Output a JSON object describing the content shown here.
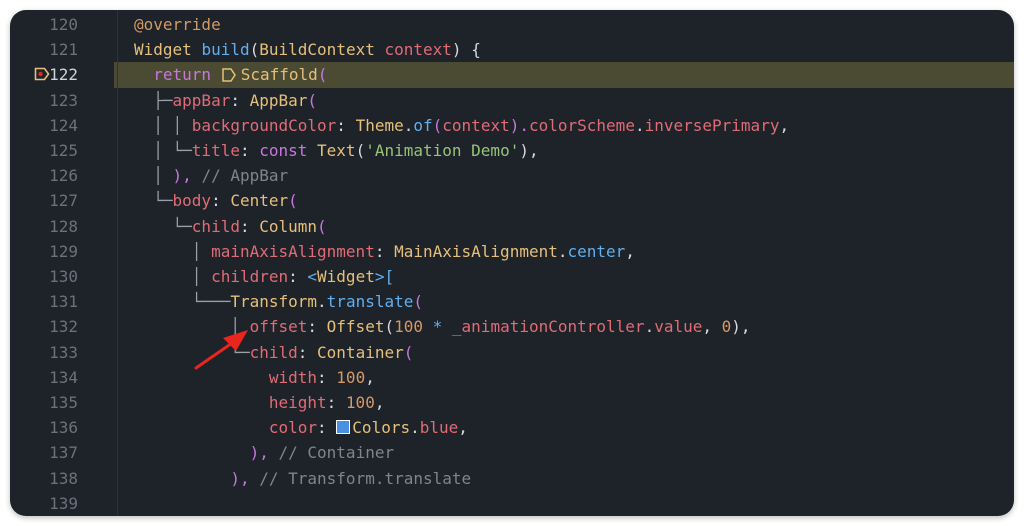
{
  "editor": {
    "lines": [
      {
        "num": "120",
        "tokens": [
          {
            "t": "@override",
            "c": "dec"
          }
        ]
      },
      {
        "num": "121",
        "tokens": [
          {
            "t": "Widget ",
            "c": "type"
          },
          {
            "t": "build",
            "c": "meth"
          },
          {
            "t": "(",
            "c": "p"
          },
          {
            "t": "BuildContext ",
            "c": "type"
          },
          {
            "t": "context",
            "c": "prop"
          },
          {
            "t": ") {",
            "c": "p"
          }
        ]
      },
      {
        "num": "122",
        "highlight": true,
        "breakpoint": true,
        "tokens": [
          {
            "t": "  return ",
            "c": "kw"
          },
          {
            "icon": "widget"
          },
          {
            "t": "Scaffold",
            "c": "type"
          },
          {
            "t": "(",
            "c": "pv"
          }
        ]
      },
      {
        "num": "123",
        "tokens": [
          {
            "t": "  ├─",
            "c": "guide"
          },
          {
            "t": "appBar",
            "c": "prop"
          },
          {
            "t": ": ",
            "c": "p"
          },
          {
            "t": "AppBar",
            "c": "type"
          },
          {
            "t": "(",
            "c": "pv"
          }
        ]
      },
      {
        "num": "124",
        "tokens": [
          {
            "t": "  │ │ ",
            "c": "guide"
          },
          {
            "t": "backgroundColor",
            "c": "prop"
          },
          {
            "t": ": ",
            "c": "p"
          },
          {
            "t": "Theme",
            "c": "type"
          },
          {
            "t": ".",
            "c": "p"
          },
          {
            "t": "of",
            "c": "meth"
          },
          {
            "t": "(",
            "c": "pv"
          },
          {
            "t": "context",
            "c": "prop"
          },
          {
            "t": ").",
            "c": "pv"
          },
          {
            "t": "colorScheme",
            "c": "prop"
          },
          {
            "t": ".",
            "c": "p"
          },
          {
            "t": "inversePrimary",
            "c": "prop"
          },
          {
            "t": ",",
            "c": "p"
          }
        ]
      },
      {
        "num": "125",
        "tokens": [
          {
            "t": "  │ └─",
            "c": "guide"
          },
          {
            "t": "title",
            "c": "prop"
          },
          {
            "t": ": ",
            "c": "p"
          },
          {
            "t": "const ",
            "c": "kw"
          },
          {
            "t": "Text",
            "c": "type"
          },
          {
            "t": "(",
            "c": "p"
          },
          {
            "t": "'Animation Demo'",
            "c": "str"
          },
          {
            "t": "),",
            "c": "p"
          }
        ]
      },
      {
        "num": "126",
        "tokens": [
          {
            "t": "  │ ",
            "c": "guide"
          },
          {
            "t": "), ",
            "c": "pv"
          },
          {
            "t": "// AppBar",
            "c": "cm"
          }
        ]
      },
      {
        "num": "127",
        "tokens": [
          {
            "t": "  └─",
            "c": "guide"
          },
          {
            "t": "body",
            "c": "prop"
          },
          {
            "t": ": ",
            "c": "p"
          },
          {
            "t": "Center",
            "c": "type"
          },
          {
            "t": "(",
            "c": "pv"
          }
        ]
      },
      {
        "num": "128",
        "tokens": [
          {
            "t": "    └─",
            "c": "guide"
          },
          {
            "t": "child",
            "c": "prop"
          },
          {
            "t": ": ",
            "c": "p"
          },
          {
            "t": "Column",
            "c": "type"
          },
          {
            "t": "(",
            "c": "pv"
          }
        ]
      },
      {
        "num": "129",
        "tokens": [
          {
            "t": "      │ ",
            "c": "guide"
          },
          {
            "t": "mainAxisAlignment",
            "c": "prop"
          },
          {
            "t": ": ",
            "c": "p"
          },
          {
            "t": "MainAxisAlignment",
            "c": "type"
          },
          {
            "t": ".",
            "c": "p"
          },
          {
            "t": "center",
            "c": "meth"
          },
          {
            "t": ",",
            "c": "p"
          }
        ]
      },
      {
        "num": "130",
        "tokens": [
          {
            "t": "      │ ",
            "c": "guide"
          },
          {
            "t": "children",
            "c": "prop"
          },
          {
            "t": ": ",
            "c": "p"
          },
          {
            "t": "<",
            "c": "meth"
          },
          {
            "t": "Widget",
            "c": "type"
          },
          {
            "t": ">[",
            "c": "meth"
          }
        ]
      },
      {
        "num": "131",
        "tokens": [
          {
            "t": "      └───",
            "c": "guide"
          },
          {
            "t": "Transform",
            "c": "type"
          },
          {
            "t": ".",
            "c": "p"
          },
          {
            "t": "translate",
            "c": "meth"
          },
          {
            "t": "(",
            "c": "pv"
          }
        ]
      },
      {
        "num": "132",
        "tokens": [
          {
            "t": "          │ ",
            "c": "guide"
          },
          {
            "t": "offset",
            "c": "prop"
          },
          {
            "t": ": ",
            "c": "p"
          },
          {
            "t": "Offset",
            "c": "type"
          },
          {
            "t": "(",
            "c": "p"
          },
          {
            "t": "100",
            "c": "num"
          },
          {
            "t": " * ",
            "c": "meth"
          },
          {
            "t": "_animationController",
            "c": "prop"
          },
          {
            "t": ".",
            "c": "p"
          },
          {
            "t": "value",
            "c": "prop"
          },
          {
            "t": ", ",
            "c": "p"
          },
          {
            "t": "0",
            "c": "num"
          },
          {
            "t": "),",
            "c": "p"
          }
        ]
      },
      {
        "num": "133",
        "tokens": [
          {
            "t": "          └─",
            "c": "guide"
          },
          {
            "t": "child",
            "c": "prop"
          },
          {
            "t": ": ",
            "c": "p"
          },
          {
            "t": "Container",
            "c": "type"
          },
          {
            "t": "(",
            "c": "pv"
          }
        ]
      },
      {
        "num": "134",
        "tokens": [
          {
            "t": "              ",
            "c": "guide"
          },
          {
            "t": "width",
            "c": "prop"
          },
          {
            "t": ": ",
            "c": "p"
          },
          {
            "t": "100",
            "c": "num"
          },
          {
            "t": ",",
            "c": "p"
          }
        ]
      },
      {
        "num": "135",
        "tokens": [
          {
            "t": "              ",
            "c": "guide"
          },
          {
            "t": "height",
            "c": "prop"
          },
          {
            "t": ": ",
            "c": "p"
          },
          {
            "t": "100",
            "c": "num"
          },
          {
            "t": ",",
            "c": "p"
          }
        ]
      },
      {
        "num": "136",
        "tokens": [
          {
            "t": "              ",
            "c": "guide"
          },
          {
            "t": "color",
            "c": "prop"
          },
          {
            "t": ": ",
            "c": "p"
          },
          {
            "swatch": "#4a90e2"
          },
          {
            "t": "Colors",
            "c": "type"
          },
          {
            "t": ".",
            "c": "p"
          },
          {
            "t": "blue",
            "c": "prop"
          },
          {
            "t": ",",
            "c": "p"
          }
        ]
      },
      {
        "num": "137",
        "tokens": [
          {
            "t": "            ",
            "c": "guide"
          },
          {
            "t": "), ",
            "c": "pv"
          },
          {
            "t": "// Container",
            "c": "cm"
          }
        ]
      },
      {
        "num": "138",
        "tokens": [
          {
            "t": "          ",
            "c": "guide"
          },
          {
            "t": "), ",
            "c": "pv"
          },
          {
            "t": "// Transform.translate",
            "c": "cm"
          }
        ]
      },
      {
        "num": "139",
        "tokens": []
      }
    ]
  },
  "annotation": {
    "icon": "red-arrow-icon",
    "color": "#e8261d"
  },
  "breakpoint_icon": "debug-breakpoint-icon",
  "colors": {
    "background": "#1e2229",
    "highlight": "#4b4a33",
    "breakpoint": "#e5c07b"
  }
}
